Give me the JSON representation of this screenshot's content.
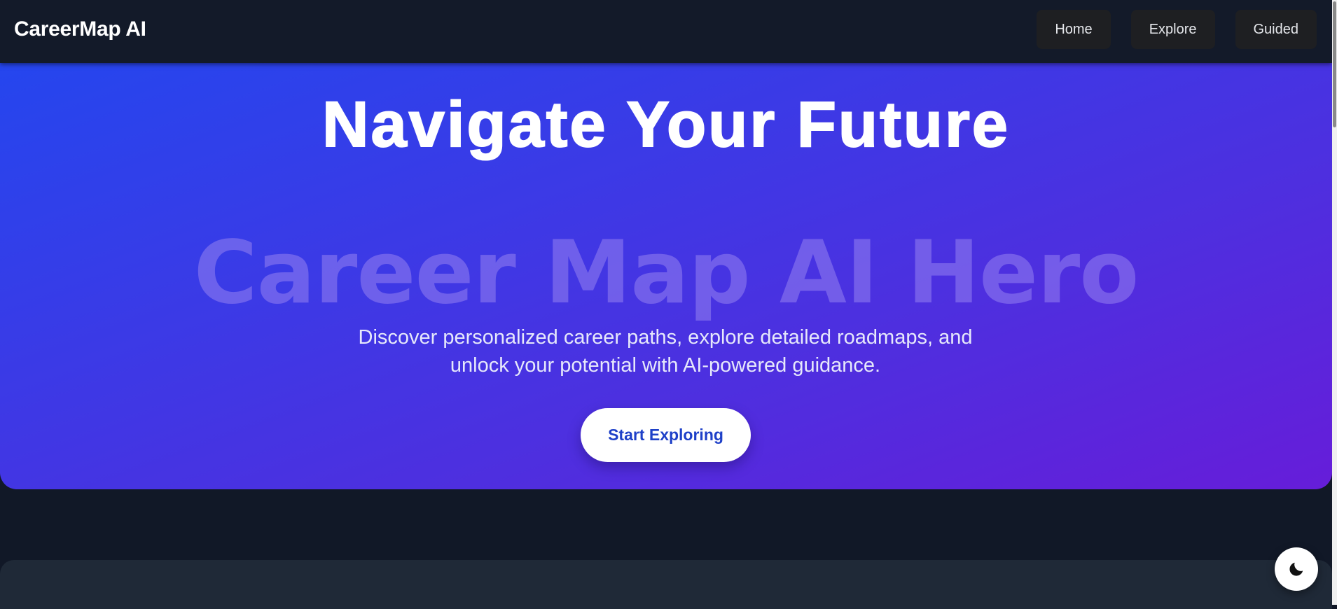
{
  "header": {
    "brand": "CareerMap AI",
    "nav": [
      {
        "label": "Home"
      },
      {
        "label": "Explore"
      },
      {
        "label": "Guided"
      }
    ]
  },
  "hero": {
    "title": "Navigate Your Future",
    "image_alt_text": "Career Map AI Hero",
    "subtitle_line1": "Discover personalized career paths, explore detailed roadmaps, and",
    "subtitle_line2": "unlock your potential with AI-powered guidance.",
    "cta_label": "Start Exploring",
    "gradient_start": "#2546ee",
    "gradient_end": "#661dd9"
  },
  "theme_toggle": {
    "icon": "moon-icon"
  },
  "colors": {
    "page_background": "#111827",
    "header_background": "#131a29",
    "nav_button_background": "#1e1f22",
    "cta_text": "#1e40c8",
    "lower_panel": "#1f2937"
  }
}
